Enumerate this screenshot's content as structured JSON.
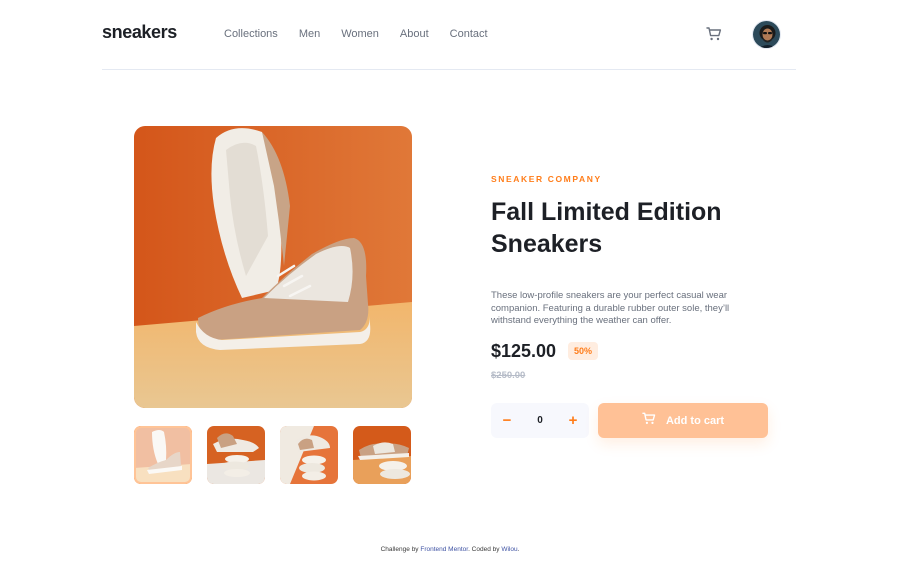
{
  "header": {
    "logo": "sneakers",
    "nav": [
      "Collections",
      "Men",
      "Women",
      "About",
      "Contact"
    ],
    "icons": {
      "cart": "cart-icon",
      "avatar": "user-avatar"
    }
  },
  "gallery": {
    "main_image": "sneaker-hero-photo",
    "thumbnails": [
      "product-thumbnail-1",
      "product-thumbnail-2",
      "product-thumbnail-3",
      "product-thumbnail-4"
    ],
    "active_thumbnail": 0
  },
  "product": {
    "company": "SNEAKER COMPANY",
    "title": "Fall Limited Edition Sneakers",
    "description": "These low-profile sneakers are your perfect casual wear companion. Featuring a durable rubber outer sole, they’ll withstand everything the weather can offer.",
    "price": "$125.00",
    "discount": "50%",
    "old_price": "$250.00"
  },
  "cart_controls": {
    "minus": "−",
    "quantity": "0",
    "plus": "+",
    "add_to_cart": "Add to cart"
  },
  "footer": {
    "prefix": "Challenge by ",
    "challenge_link": "Frontend Mentor",
    "middle": ". Coded by ",
    "author_link": "Wilou",
    "suffix": "."
  },
  "colors": {
    "accent": "#ff7d1a",
    "accent_pale": "#ffede0",
    "button_bg": "#ffc196",
    "text_dark": "#1d2026",
    "text_muted": "#69707d"
  }
}
